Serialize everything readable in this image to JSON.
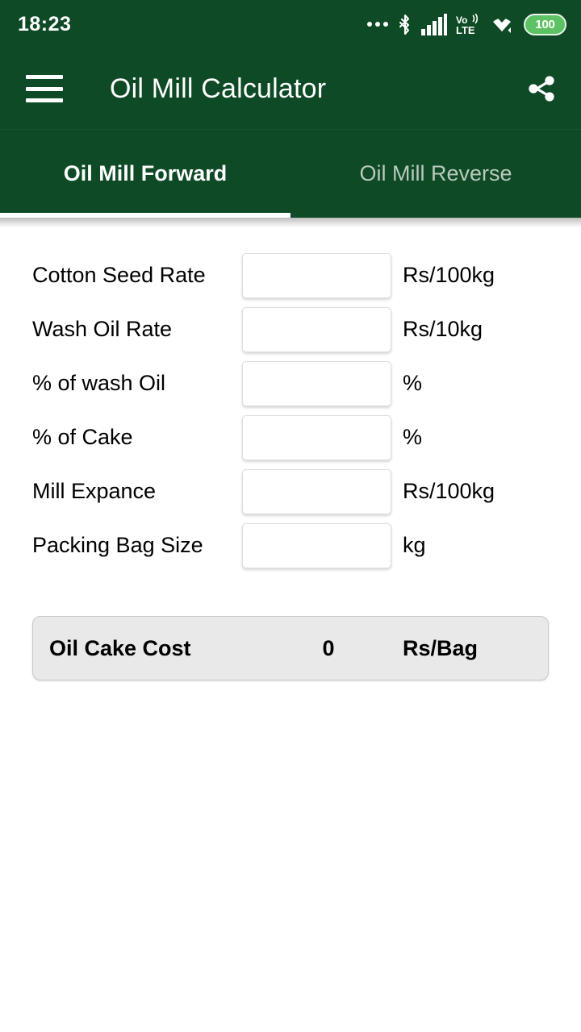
{
  "status_bar": {
    "time": "18:23",
    "battery_level": "100",
    "icons": [
      "more-dots-icon",
      "bluetooth-icon",
      "signal-bars-icon",
      "volte-icon",
      "wifi-icon",
      "battery-icon"
    ],
    "network_label": "VoLTE",
    "background_color": "#0d4a25"
  },
  "app_bar": {
    "menu_icon": "hamburger-menu-icon",
    "title": "Oil Mill Calculator",
    "share_icon": "share-icon",
    "background_color": "#0d4a25"
  },
  "tabs": {
    "items": [
      {
        "label": "Oil Mill Forward",
        "active": true
      },
      {
        "label": "Oil Mill Reverse",
        "active": false
      }
    ],
    "indicator_color": "#ffffff"
  },
  "form": {
    "rows": [
      {
        "label": "Cotton Seed Rate",
        "value": "",
        "placeholder": "",
        "unit": "Rs/100kg"
      },
      {
        "label": "Wash Oil Rate",
        "value": "",
        "placeholder": "",
        "unit": "Rs/10kg"
      },
      {
        "label": "% of wash Oil",
        "value": "",
        "placeholder": "",
        "unit": "%"
      },
      {
        "label": "% of Cake",
        "value": "",
        "placeholder": "",
        "unit": "%"
      },
      {
        "label": "Mill Expance",
        "value": "",
        "placeholder": "",
        "unit": "Rs/100kg"
      },
      {
        "label": "Packing Bag Size",
        "value": "",
        "placeholder": "",
        "unit": "kg"
      }
    ]
  },
  "result": {
    "label": "Oil Cake Cost",
    "value": "0",
    "unit": "Rs/Bag",
    "background_color": "#e9e9e9"
  }
}
